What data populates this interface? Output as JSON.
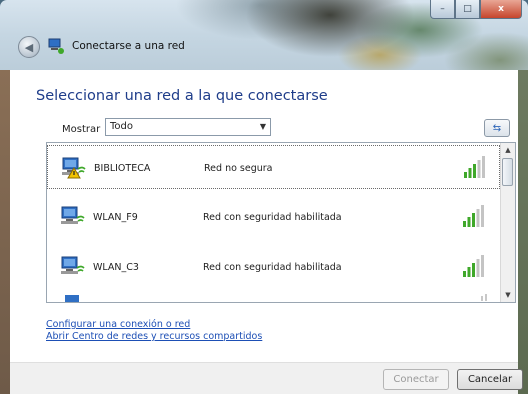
{
  "window": {
    "title": "Conectarse a una red",
    "caption_buttons": {
      "minimize": "–",
      "maximize": "□",
      "close": "x"
    }
  },
  "heading": "Seleccionar una red a la que conectarse",
  "filter": {
    "label": "Mostrar",
    "value": "Todo"
  },
  "networks": [
    {
      "name": "BIBLIOTECA",
      "security": "Red no segura",
      "icon": "wireless-network-unsecured-icon",
      "signal_bars": 5
    },
    {
      "name": "WLAN_F9",
      "security": "Red con seguridad habilitada",
      "icon": "wireless-network-icon",
      "signal_bars": 5
    },
    {
      "name": "WLAN_C3",
      "security": "Red con seguridad habilitada",
      "icon": "wireless-network-icon",
      "signal_bars": 5
    }
  ],
  "links": {
    "configure": "Configurar una conexión o red",
    "network_center": "Abrir Centro de redes y recursos compartidos"
  },
  "buttons": {
    "connect": "Conectar",
    "cancel": "Cancelar"
  },
  "colors": {
    "heading": "#1f3d8a",
    "link": "#1d4fb5",
    "signal": "#3fa82a"
  }
}
